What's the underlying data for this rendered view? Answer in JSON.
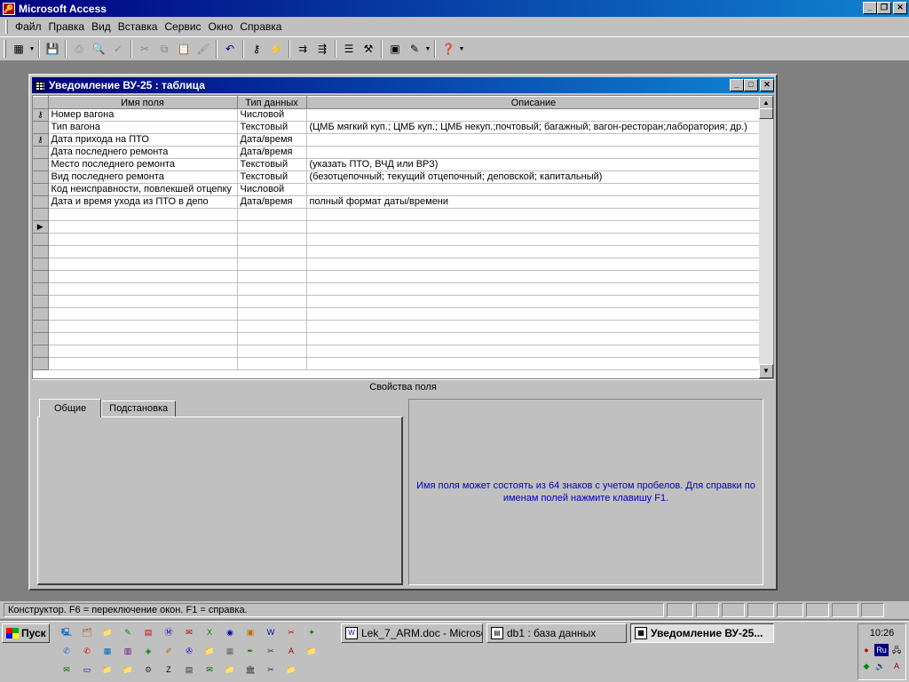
{
  "app": {
    "title": "Microsoft Access"
  },
  "menu": [
    "Файл",
    "Правка",
    "Вид",
    "Вставка",
    "Сервис",
    "Окно",
    "Справка"
  ],
  "toolbar": {
    "icons": [
      "table-view-icon",
      "save-icon",
      "print-icon",
      "print-preview-icon",
      "spelling-icon",
      "cut-icon",
      "copy-icon",
      "paste-icon",
      "format-painter-icon",
      "undo-icon",
      "primary-key-icon",
      "build-icon",
      "insert-rows-icon",
      "delete-rows-icon",
      "properties-icon",
      "build-wand-icon",
      "database-window-icon",
      "new-object-icon",
      "help-icon"
    ]
  },
  "child": {
    "title": "Уведомление ВУ-25 : таблица",
    "columns": {
      "name": "Имя поля",
      "type": "Тип данных",
      "desc": "Описание"
    },
    "rows": [
      {
        "key": true,
        "name": "Номер вагона",
        "type": "Числовой",
        "desc": ""
      },
      {
        "key": false,
        "name": "Тип вагона",
        "type": "Текстовый",
        "desc": "(ЦМБ мягкий куп.; ЦМБ куп.; ЦМБ некуп.;почтовый; багажный; вагон-ресторан;лаборатория; др.)"
      },
      {
        "key": true,
        "name": "Дата прихода на ПТО",
        "type": "Дата/время",
        "desc": ""
      },
      {
        "key": false,
        "name": "Дата последнего ремонта",
        "type": "Дата/время",
        "desc": ""
      },
      {
        "key": false,
        "name": "Место последнего ремонта",
        "type": "Текстовый",
        "desc": "(указать ПТО, ВЧД или ВРЗ)"
      },
      {
        "key": false,
        "name": "Вид последнего ремонта",
        "type": "Текстовый",
        "desc": "(безотцепочный; текущий отцепочный; деповской; капитальный)"
      },
      {
        "key": false,
        "name": "Код неисправности, повлекшей отцепку",
        "type": "Числовой",
        "desc": ""
      },
      {
        "key": false,
        "name": "Дата и время ухода из ПТО в депо",
        "type": "Дата/время",
        "desc": "полный формат даты/времени"
      }
    ],
    "properties_label": "Свойства поля",
    "tabs": [
      "Общие",
      "Подстановка"
    ],
    "help_text": "Имя поля может состоять из 64 знаков с учетом пробелов.  Для справки по именам полей нажмите клавишу F1."
  },
  "status": {
    "text": "Конструктор.  F6 = переключение окон.  F1 = справка."
  },
  "taskbar": {
    "start": "Пуск",
    "tasks": [
      {
        "label": "Lek_7_ARM.doc - Microso...",
        "icon": "word-doc-icon",
        "active": false
      },
      {
        "label": "db1 : база данных",
        "icon": "database-icon",
        "active": false
      },
      {
        "label": "Уведомление ВУ-25...",
        "icon": "table-icon",
        "active": true
      }
    ],
    "clock": "10:26",
    "lang": "Ru"
  }
}
